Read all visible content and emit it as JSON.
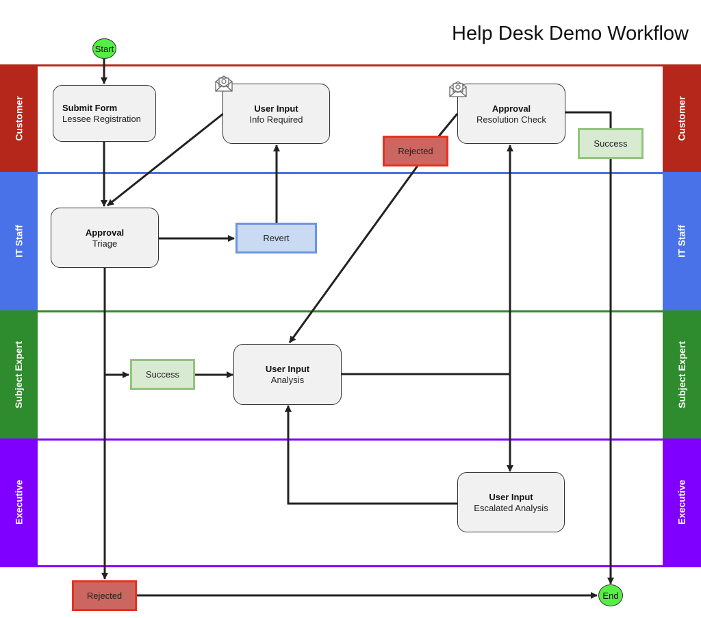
{
  "title": "Help Desk Demo Workflow",
  "lanes": [
    {
      "name": "Customer",
      "color": "#b5271b"
    },
    {
      "name": "IT Staff",
      "color": "#4a72e8"
    },
    {
      "name": "Subject Expert",
      "color": "#2e8b2e"
    },
    {
      "name": "Executive",
      "color": "#8000ff"
    }
  ],
  "events": {
    "start": "Start",
    "end": "End"
  },
  "tasks": {
    "submit_form": {
      "type": "Submit Form",
      "name": "Lessee Registration",
      "lane": "Customer"
    },
    "info_required": {
      "type": "User Input",
      "name": "Info Required",
      "lane": "Customer",
      "icon": "email-icon"
    },
    "resolution_check": {
      "type": "Approval",
      "name": "Resolution Check",
      "lane": "Customer",
      "icon": "email-icon"
    },
    "triage": {
      "type": "Approval",
      "name": "Triage",
      "lane": "IT Staff"
    },
    "analysis": {
      "type": "User Input",
      "name": "Analysis",
      "lane": "Subject Expert"
    },
    "escalated_analysis": {
      "type": "User Input",
      "name": "Escalated Analysis",
      "lane": "Executive"
    }
  },
  "statuses": {
    "rejected_customer": {
      "label": "Rejected",
      "fill": "#cc6660",
      "border": "#e8301f"
    },
    "success_customer": {
      "label": "Success",
      "fill": "#d9ead3",
      "border": "#93c47d"
    },
    "revert": {
      "label": "Revert",
      "fill": "#c9daf2",
      "border": "#6d93e3"
    },
    "success_expert": {
      "label": "Success",
      "fill": "#d9ead3",
      "border": "#93c47d"
    },
    "rejected_final": {
      "label": "Rejected",
      "fill": "#cc6660",
      "border": "#e8301f"
    }
  },
  "edges": [
    {
      "from": "Start",
      "to": "Submit Form / Lessee Registration"
    },
    {
      "from": "Submit Form / Lessee Registration",
      "to": "Approval / Triage"
    },
    {
      "from": "User Input / Info Required",
      "to": "Approval / Triage"
    },
    {
      "from": "Approval / Triage",
      "to": "Revert"
    },
    {
      "from": "Revert",
      "to": "User Input / Info Required"
    },
    {
      "from": "Approval / Triage",
      "to": "Success (Subject Expert)"
    },
    {
      "from": "Approval / Triage",
      "to": "Rejected (final)"
    },
    {
      "from": "Success (Subject Expert)",
      "to": "User Input / Analysis"
    },
    {
      "from": "User Input / Analysis",
      "to": "Approval / Resolution Check"
    },
    {
      "from": "User Input / Analysis",
      "to": "User Input / Escalated Analysis"
    },
    {
      "from": "User Input / Escalated Analysis",
      "to": "User Input / Analysis"
    },
    {
      "from": "Approval / Resolution Check",
      "to": "Rejected (Customer)"
    },
    {
      "from": "Rejected (Customer)",
      "to": "User Input / Analysis"
    },
    {
      "from": "Approval / Resolution Check",
      "to": "Success (Customer)"
    },
    {
      "from": "Success (Customer)",
      "to": "End"
    },
    {
      "from": "Rejected (final)",
      "to": "End"
    }
  ]
}
